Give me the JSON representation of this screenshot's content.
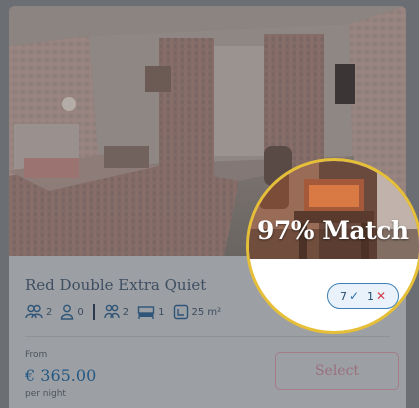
{
  "room": {
    "name": "Red Double Extra Quiet",
    "amenities": [
      {
        "icon": "adults-icon",
        "value": "2"
      },
      {
        "icon": "child-icon",
        "value": "0"
      },
      {
        "icon": "guests-icon",
        "value": "2"
      },
      {
        "icon": "bed-icon",
        "value": "1"
      },
      {
        "icon": "room-size-icon",
        "value": "25 m²"
      }
    ]
  },
  "pricing": {
    "from_label": "From",
    "price": "€ 365.00",
    "unit": "per night"
  },
  "actions": {
    "select_label": "Select"
  },
  "match": {
    "text": "97% Match",
    "matched_count": "7",
    "matched_icon": "check-icon",
    "unmatched_count": "1",
    "unmatched_icon": "cross-icon"
  },
  "colors": {
    "highlight_ring": "#e6bf38",
    "accent_blue": "#245983",
    "unmatched_red": "#d33b4b"
  }
}
